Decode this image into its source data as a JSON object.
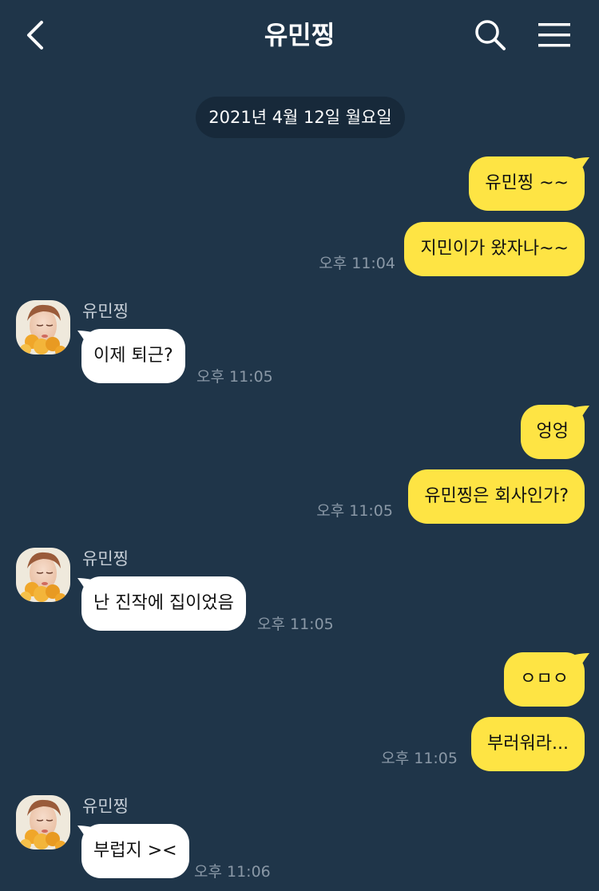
{
  "header": {
    "title": "유민찡"
  },
  "date_divider": "2021년 4월 12일 월요일",
  "colors": {
    "background": "#1f3549",
    "my_bubble": "#fee444",
    "their_bubble": "#ffffff",
    "date_pill": "#17293a"
  },
  "messages": [
    {
      "from": "me",
      "text": "유민찡 ~~"
    },
    {
      "from": "me",
      "text": "지민이가 왔자나~~",
      "time": "오후 11:04"
    },
    {
      "from": "them",
      "sender": "유민찡",
      "text": "이제 퇴근?",
      "time": "오후 11:05"
    },
    {
      "from": "me",
      "text": "엉엉"
    },
    {
      "from": "me",
      "text": "유민찡은 회사인가?",
      "time": "오후 11:05"
    },
    {
      "from": "them",
      "sender": "유민찡",
      "text": "난 진작에 집이었음",
      "time": "오후 11:05"
    },
    {
      "from": "me",
      "text": "ㅇㅁㅇ"
    },
    {
      "from": "me",
      "text": "부러워라...",
      "time": "오후 11:05"
    },
    {
      "from": "them",
      "sender": "유민찡",
      "text": "부럽지 ><",
      "time": "오후 11:06"
    }
  ]
}
